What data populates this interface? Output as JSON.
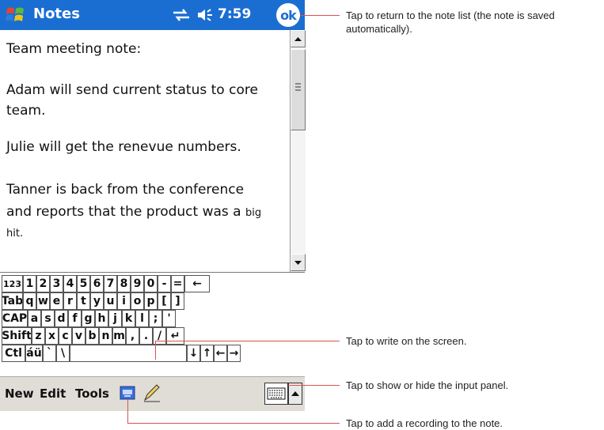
{
  "titlebar": {
    "title": "Notes",
    "time": "7:59",
    "ok_label": "ok"
  },
  "note": {
    "lines": [
      "Team meeting note:",
      "Adam will send current status to core",
      "team.",
      "Julie will get the renevue numbers.",
      "Tanner is back from the conference",
      "and reports that the product was a",
      "big",
      "hit."
    ]
  },
  "keyboard": {
    "row1": [
      "123",
      "1",
      "2",
      "3",
      "4",
      "5",
      "6",
      "7",
      "8",
      "9",
      "0",
      "-",
      "=",
      "←"
    ],
    "row2": [
      "Tab",
      "q",
      "w",
      "e",
      "r",
      "t",
      "y",
      "u",
      "i",
      "o",
      "p",
      "[",
      "]"
    ],
    "row3": [
      "CAP",
      "a",
      "s",
      "d",
      "f",
      "g",
      "h",
      "j",
      "k",
      "l",
      ";",
      "'"
    ],
    "row4": [
      "Shift",
      "z",
      "x",
      "c",
      "v",
      "b",
      "n",
      "m",
      ",",
      ".",
      "/",
      "↵"
    ],
    "row5": [
      "Ctl",
      "áü",
      "`",
      "\\",
      "",
      "↓",
      "↑",
      "←",
      "→"
    ]
  },
  "menubar": {
    "new_label": "New",
    "edit_label": "Edit",
    "tools_label": "Tools"
  },
  "callouts": {
    "ok": "Tap to return to the note list (the note is saved automatically).",
    "write": "Tap to write on the screen.",
    "input_panel": "Tap to show or hide the input panel.",
    "recording": "Tap to add a recording to the note."
  },
  "colors": {
    "titlebar": "#1a6ed1",
    "menubar": "#e0ddd6",
    "callout_line": "#d9534f"
  }
}
